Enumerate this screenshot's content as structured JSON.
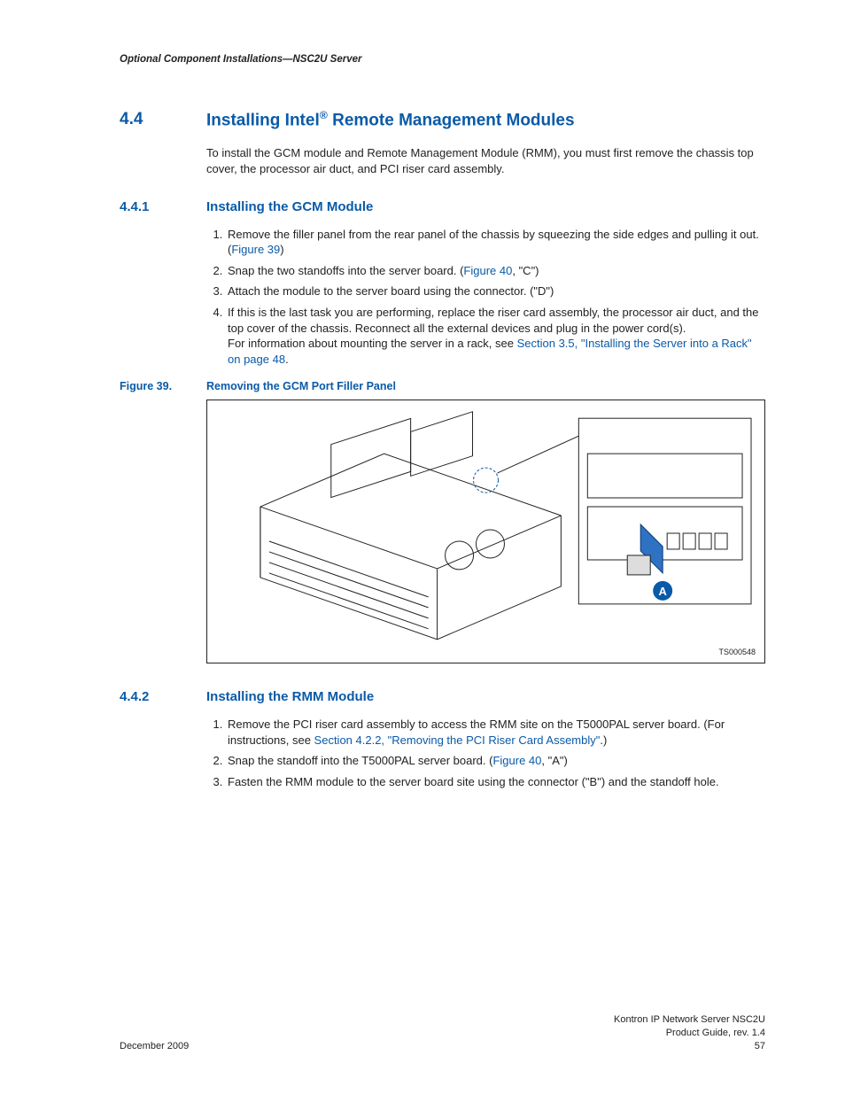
{
  "header": {
    "running_head": "Optional Component Installations—NSC2U Server"
  },
  "section": {
    "number": "4.4",
    "title_pre": "Installing Intel",
    "title_post": " Remote Management Modules",
    "intro": "To install the GCM module and Remote Management Module (RMM), you must first remove the chassis top cover, the processor air duct, and PCI riser card assembly."
  },
  "sub1": {
    "number": "4.4.1",
    "title": "Installing the GCM Module",
    "steps": {
      "s1a": " Remove the filler panel from the rear panel of the chassis by squeezing the side edges and pulling it out. (",
      "s1link": "Figure 39",
      "s1b": ")",
      "s2a": "Snap the two standoffs into the server board. (",
      "s2link": "Figure 40",
      "s2b": ", \"C\")",
      "s3": "Attach the module to the server board using the connector. (\"D\")",
      "s4a": "If this is the last task you are performing, replace the riser card assembly, the processor air duct, and the top cover of the chassis. Reconnect all the external devices and plug in the power cord(s).",
      "s4b": "For information about mounting the server in a rack, see ",
      "s4link": "Section 3.5, \"Installing the Server into a Rack\" on page 48",
      "s4c": "."
    }
  },
  "figure": {
    "label": "Figure 39.",
    "caption": "Removing the GCM Port Filler Panel",
    "callout": "A",
    "id": "TS000548"
  },
  "sub2": {
    "number": "4.4.2",
    "title": "Installing the RMM Module",
    "steps": {
      "s1a": "Remove the PCI riser card assembly to access the RMM site on the T5000PAL server board. (For instructions, see ",
      "s1link": "Section 4.2.2, \"Removing the PCI Riser Card Assembly\"",
      "s1b": ".)",
      "s2a": "Snap the standoff into the T5000PAL server board. (",
      "s2link": "Figure 40",
      "s2b": ", \"A\")",
      "s3": "Fasten the RMM module to the server board site using the connector (\"B\") and the standoff hole."
    }
  },
  "footer": {
    "date": "December 2009",
    "doc1": "Kontron IP Network Server NSC2U",
    "doc2": "Product Guide, rev. 1.4",
    "page": "57"
  }
}
